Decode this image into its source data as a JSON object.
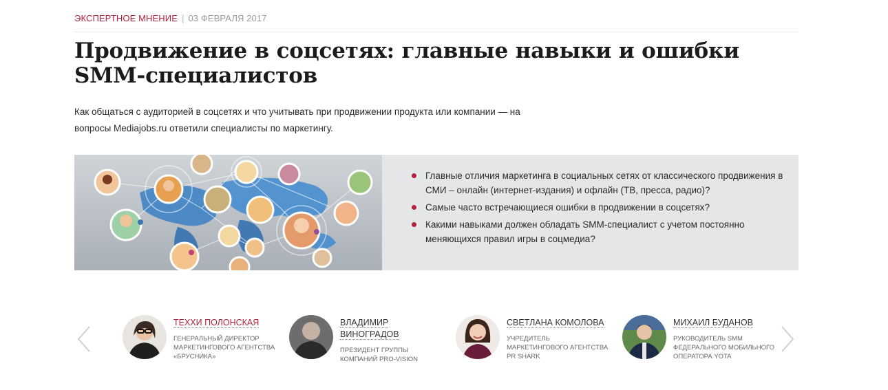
{
  "article": {
    "category": "ЭКСПЕРТНОЕ МНЕНИЕ",
    "separator": "|",
    "date": "03 ФЕВРАЛЯ 2017",
    "title": "Продвижение в соцсетях: главные навыки и ошибки SMM-специалистов",
    "lead": "Как общаться с аудиторией в соцсетях и что учитывать при продвижении продукта или компании — на вопросы Mediajobs.ru ответили специалисты по маркетингу."
  },
  "banner": {
    "image_icon": "social-network-illustration",
    "bullets": [
      "Главные отличия маркетинга в социальных сетях от классического продвижения в СМИ – онлайн (интернет-издания) и офлайн (ТВ, пресса, радио)?",
      "Самые часто встречающиеся ошибки в продвижении в соцсетях?",
      "Какими навыками должен обладать SMM-специалист с учетом постоянно меняющихся правил игры в соцмедиа?"
    ],
    "bullet_color": "#b3223d"
  },
  "experts": [
    {
      "name": "ТЕХХИ ПОЛОНСКАЯ",
      "role": "ГЕНЕРАЛЬНЫЙ ДИРЕКТОР МАРКЕТИНГОВОГО АГЕНТСТВА «БРУСНИКА»",
      "highlighted": true
    },
    {
      "name": "ВЛАДИМИР ВИНОГРАДОВ",
      "role": "ПРЕЗИДЕНТ ГРУППЫ КОМПАНИЙ PRO-VISION",
      "highlighted": false
    },
    {
      "name": "СВЕТЛАНА КОМОЛОВА",
      "role": "УЧРЕДИТЕЛЬ МАРКЕТИНГОВОГО АГЕНТСТВА PR SHARK",
      "highlighted": false
    },
    {
      "name": "МИХАИЛ БУДАНОВ",
      "role": "РУКОВОДИТЕЛЬ SMM ФЕДЕРАЛЬНОГО МОБИЛЬНОГО ОПЕРАТОРА YOTA",
      "highlighted": false
    }
  ],
  "carousel": {
    "prev_icon": "chevron-left-icon",
    "next_icon": "chevron-right-icon"
  },
  "colors": {
    "accent": "#b3223d",
    "muted": "#9a9a9a",
    "banner_bg": "#e4e6e8"
  }
}
